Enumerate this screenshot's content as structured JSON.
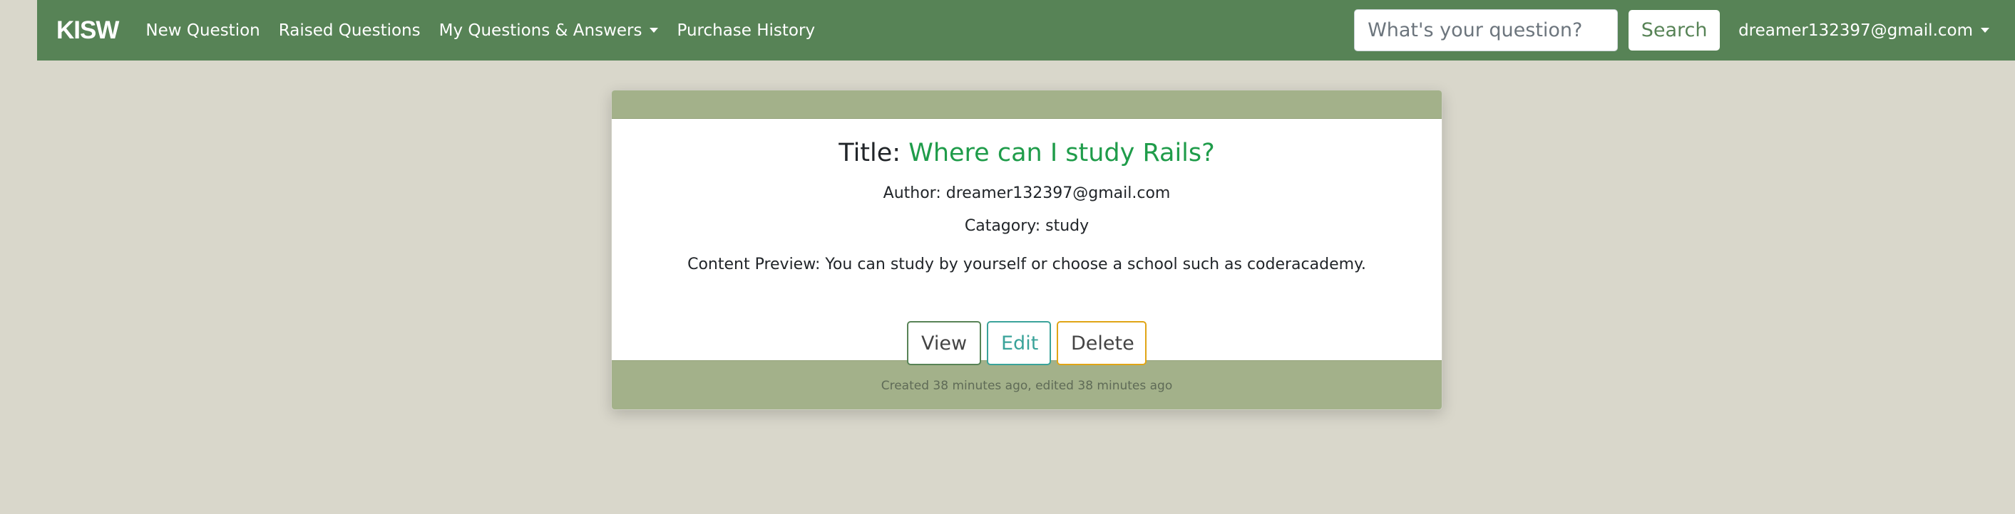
{
  "navbar": {
    "brand": "KISW",
    "links": [
      {
        "label": "New Question"
      },
      {
        "label": "Raised Questions"
      },
      {
        "label": "My Questions & Answers"
      },
      {
        "label": "Purchase History"
      }
    ],
    "search": {
      "placeholder": "What's your question?",
      "value": "",
      "button_label": "Search"
    },
    "user_email": "dreamer132397@gmail.com"
  },
  "question": {
    "title_label": "Title:",
    "title": "Where can I study Rails?",
    "author": "Author: dreamer132397@gmail.com",
    "category": "Catagory: study",
    "preview": "Content Preview: You can study by yourself or choose a school such as coderacademy.",
    "actions": {
      "view": "View",
      "edit": "Edit",
      "delete": "Delete"
    },
    "footer": "Created 38 minutes ago, edited 38 minutes ago"
  },
  "colors": {
    "navbar_bg": "#578356",
    "page_bg": "#d9d7cb",
    "card_band": "#a3b18a",
    "title_link": "#1f9c4a",
    "view_border": "#578356",
    "edit_border": "#3aa39a",
    "delete_border": "#e0a516"
  },
  "icons": {
    "dropdown_caret": "caret-down-icon"
  }
}
